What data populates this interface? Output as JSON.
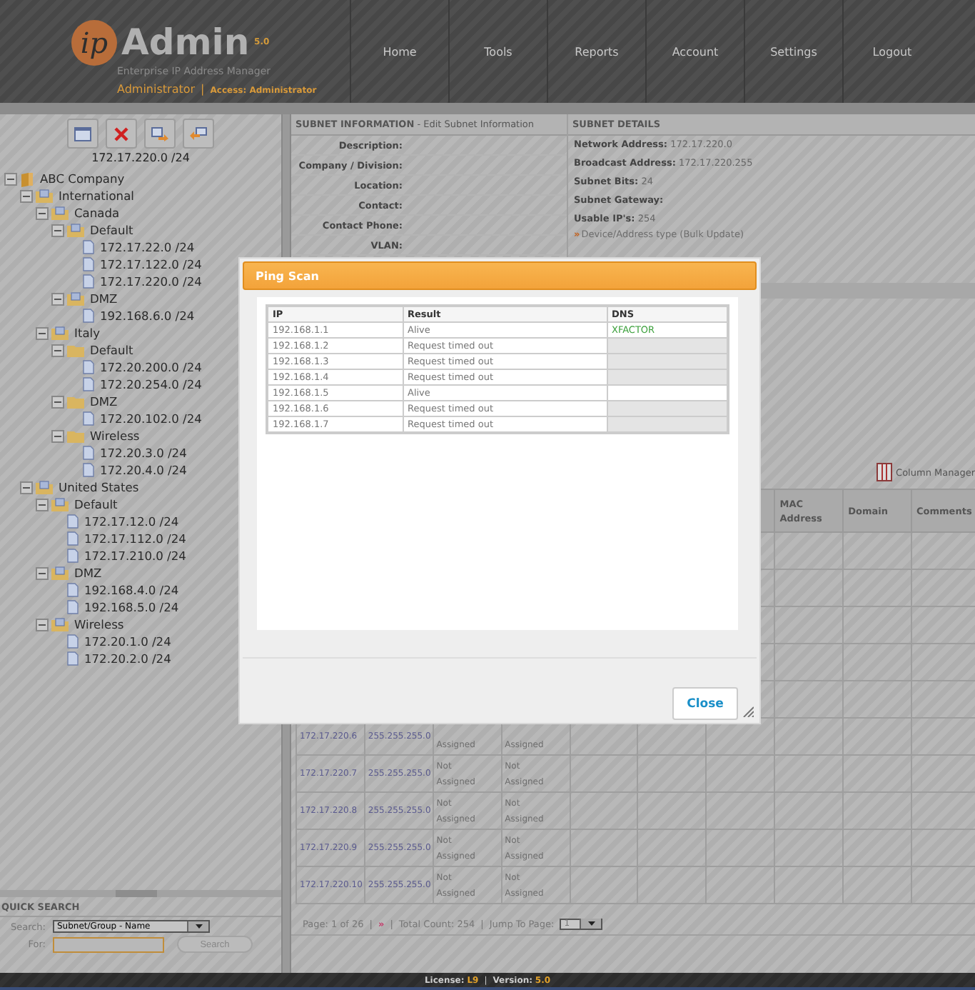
{
  "header": {
    "logo_mark": "ip",
    "product": "Admin",
    "version": "5.0",
    "tagline": "Enterprise IP Address Manager",
    "user": "Administrator",
    "separator": "|",
    "access_label": "Access:",
    "access": "Administrator"
  },
  "nav": [
    {
      "label": "Home"
    },
    {
      "label": "Tools"
    },
    {
      "label": "Reports"
    },
    {
      "label": "Account"
    },
    {
      "label": "Settings"
    },
    {
      "label": "Logout"
    }
  ],
  "sidebar": {
    "current_subnet": "172.17.220.0 /24",
    "tree": [
      {
        "label": "ABC Company",
        "kind": "company",
        "expanded": true,
        "children": [
          {
            "label": "International",
            "kind": "group",
            "expanded": true,
            "children": [
              {
                "label": "Canada",
                "kind": "group",
                "expanded": true,
                "children": [
                  {
                    "label": "Default",
                    "kind": "group",
                    "expanded": true,
                    "children": [
                      {
                        "label": "172.17.22.0 /24",
                        "kind": "subnet"
                      },
                      {
                        "label": "172.17.122.0 /24",
                        "kind": "subnet"
                      },
                      {
                        "label": "172.17.220.0 /24",
                        "kind": "subnet"
                      }
                    ]
                  },
                  {
                    "label": "DMZ",
                    "kind": "group",
                    "expanded": true,
                    "children": [
                      {
                        "label": "192.168.6.0 /24",
                        "kind": "subnet"
                      }
                    ]
                  }
                ]
              },
              {
                "label": "Italy",
                "kind": "group",
                "expanded": true,
                "children": [
                  {
                    "label": "Default",
                    "kind": "folder",
                    "expanded": true,
                    "children": [
                      {
                        "label": "172.20.200.0 /24",
                        "kind": "subnet"
                      },
                      {
                        "label": "172.20.254.0 /24",
                        "kind": "subnet"
                      }
                    ]
                  },
                  {
                    "label": "DMZ",
                    "kind": "folder",
                    "expanded": true,
                    "children": [
                      {
                        "label": "172.20.102.0 /24",
                        "kind": "subnet"
                      }
                    ]
                  },
                  {
                    "label": "Wireless",
                    "kind": "folder",
                    "expanded": true,
                    "children": [
                      {
                        "label": "172.20.3.0 /24",
                        "kind": "subnet"
                      },
                      {
                        "label": "172.20.4.0 /24",
                        "kind": "subnet"
                      }
                    ]
                  }
                ]
              }
            ]
          },
          {
            "label": "United States",
            "kind": "group",
            "expanded": true,
            "children": [
              {
                "label": "Default",
                "kind": "group",
                "expanded": true,
                "children": [
                  {
                    "label": "172.17.12.0 /24",
                    "kind": "subnet"
                  },
                  {
                    "label": "172.17.112.0 /24",
                    "kind": "subnet"
                  },
                  {
                    "label": "172.17.210.0 /24",
                    "kind": "subnet"
                  }
                ]
              },
              {
                "label": "DMZ",
                "kind": "group",
                "expanded": true,
                "children": [
                  {
                    "label": "192.168.4.0 /24",
                    "kind": "subnet"
                  },
                  {
                    "label": "192.168.5.0 /24",
                    "kind": "subnet"
                  }
                ]
              },
              {
                "label": "Wireless",
                "kind": "group",
                "expanded": true,
                "children": [
                  {
                    "label": "172.20.1.0 /24",
                    "kind": "subnet"
                  },
                  {
                    "label": "172.20.2.0 /24",
                    "kind": "subnet"
                  }
                ]
              }
            ]
          }
        ]
      }
    ],
    "quick_search": {
      "title": "QUICK SEARCH",
      "search_label": "Search:",
      "search_value": "Subnet/Group - Name",
      "for_label": "For:",
      "button": "Search"
    }
  },
  "subnet_info": {
    "title": "**SUBNET INFORMATION** - Edit Subnet Information",
    "fields": [
      "Description:",
      "Company / Division:",
      "Location:",
      "Contact:",
      "Contact Phone:",
      "VLAN:"
    ]
  },
  "subnet_details": {
    "title": "SUBNET DETAILS",
    "items": [
      {
        "label": "Network Address:",
        "value": "172.17.220.0"
      },
      {
        "label": "Broadcast Address:",
        "value": "172.17.220.255"
      },
      {
        "label": "Subnet Bits:",
        "value": "24"
      },
      {
        "label": "Subnet Gateway:"
      },
      {
        "label": "Usable IP's:",
        "value": "254"
      }
    ],
    "links": [
      {
        "marker": "»",
        "label": "Device/Address type (Bulk Update)"
      }
    ]
  },
  "column_manager": "Column Manager",
  "table": {
    "columns": [
      "MAC Address",
      "Domain",
      "Comments"
    ],
    "rows": [
      {
        "cells": [
          "172.17.220.6",
          "255.255.255.0",
          "Assigned",
          "Assigned"
        ]
      },
      {
        "cells": [
          "172.17.220.7",
          "255.255.255.0",
          "Not Assigned",
          "Not Assigned"
        ]
      },
      {
        "cells": [
          "172.17.220.8",
          "255.255.255.0",
          "Not Assigned",
          "Not Assigned"
        ]
      },
      {
        "cells": [
          "172.17.220.9",
          "255.255.255.0",
          "Not Assigned",
          "Not Assigned"
        ]
      },
      {
        "cells": [
          "172.17.220.10",
          "255.255.255.0",
          "Not Assigned",
          "Not Assigned"
        ]
      }
    ],
    "pager": {
      "page": "Page: 1 of 26",
      "separator": "|",
      "next": "»",
      "total": "Total Count: 254",
      "jump_label": "Jump To Page:",
      "jump_value": "1"
    }
  },
  "status_bar": {
    "license_label": "License:",
    "license": "L9",
    "separator": "|",
    "version_label": "Version:",
    "version": "5.0"
  },
  "dialog": {
    "title": "Ping Scan",
    "columns": [
      "IP",
      "Result",
      "DNS"
    ],
    "rows": [
      {
        "ip": "192.168.1.1",
        "result": "Alive",
        "alive": true,
        "dns": "XFACTOR"
      },
      {
        "ip": "192.168.1.2",
        "result": "Request timed out",
        "alive": false
      },
      {
        "ip": "192.168.1.3",
        "result": "Request timed out",
        "alive": false
      },
      {
        "ip": "192.168.1.4",
        "result": "Request timed out",
        "alive": false
      },
      {
        "ip": "192.168.1.5",
        "result": "Alive",
        "alive": true
      },
      {
        "ip": "192.168.1.6",
        "result": "Request timed out",
        "alive": false
      },
      {
        "ip": "192.168.1.7",
        "result": "Request timed out",
        "alive": false
      }
    ],
    "button": "Close"
  }
}
